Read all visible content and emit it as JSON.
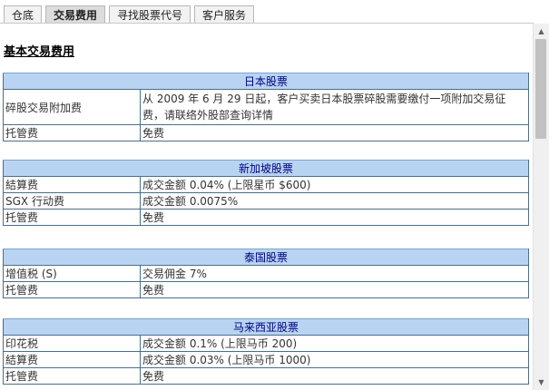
{
  "tabs": [
    {
      "label": "仓底"
    },
    {
      "label": "交易费用"
    },
    {
      "label": "寻找股票代号"
    },
    {
      "label": "客户服务"
    }
  ],
  "active_tab": "交易费用",
  "page_title": "基本交易费用",
  "sections": {
    "japan": {
      "title": "日本股票",
      "rows": [
        {
          "label": "碎股交易附加费",
          "value": "从 2009 年 6 月 29 日起，客户买卖日本股票碎股需要缴付一项附加交易征费，请联络外股部查询详情"
        },
        {
          "label": "托管费",
          "value": "免费"
        }
      ]
    },
    "singapore": {
      "title": "新加坡股票",
      "rows": [
        {
          "label": "結算费",
          "value": "成交金额 0.04% (上限星币 $600)"
        },
        {
          "label": "SGX 行动费",
          "value": "成交金额 0.0075%"
        },
        {
          "label": "托管费",
          "value": "免费"
        }
      ]
    },
    "thailand": {
      "title": "泰国股票",
      "rows": [
        {
          "label": "增值税 (S)",
          "value": "交易佣金 7%"
        },
        {
          "label": "托管费",
          "value": "免费"
        }
      ]
    },
    "malaysia": {
      "title": "马来西亚股票",
      "rows": [
        {
          "label": "印花税",
          "value": "成交金额 0.1% (上限马币 200)"
        },
        {
          "label": "結算费",
          "value": "成交金额 0.03% (上限马币 1000)"
        },
        {
          "label": "托管费",
          "value": "免费"
        }
      ]
    }
  },
  "scrollbar": {
    "up_icon": "▲",
    "down_icon": "▼"
  },
  "colors": {
    "header_bg": "#b9d4f2",
    "header_text": "#000080",
    "border": "#4a6f8a"
  }
}
